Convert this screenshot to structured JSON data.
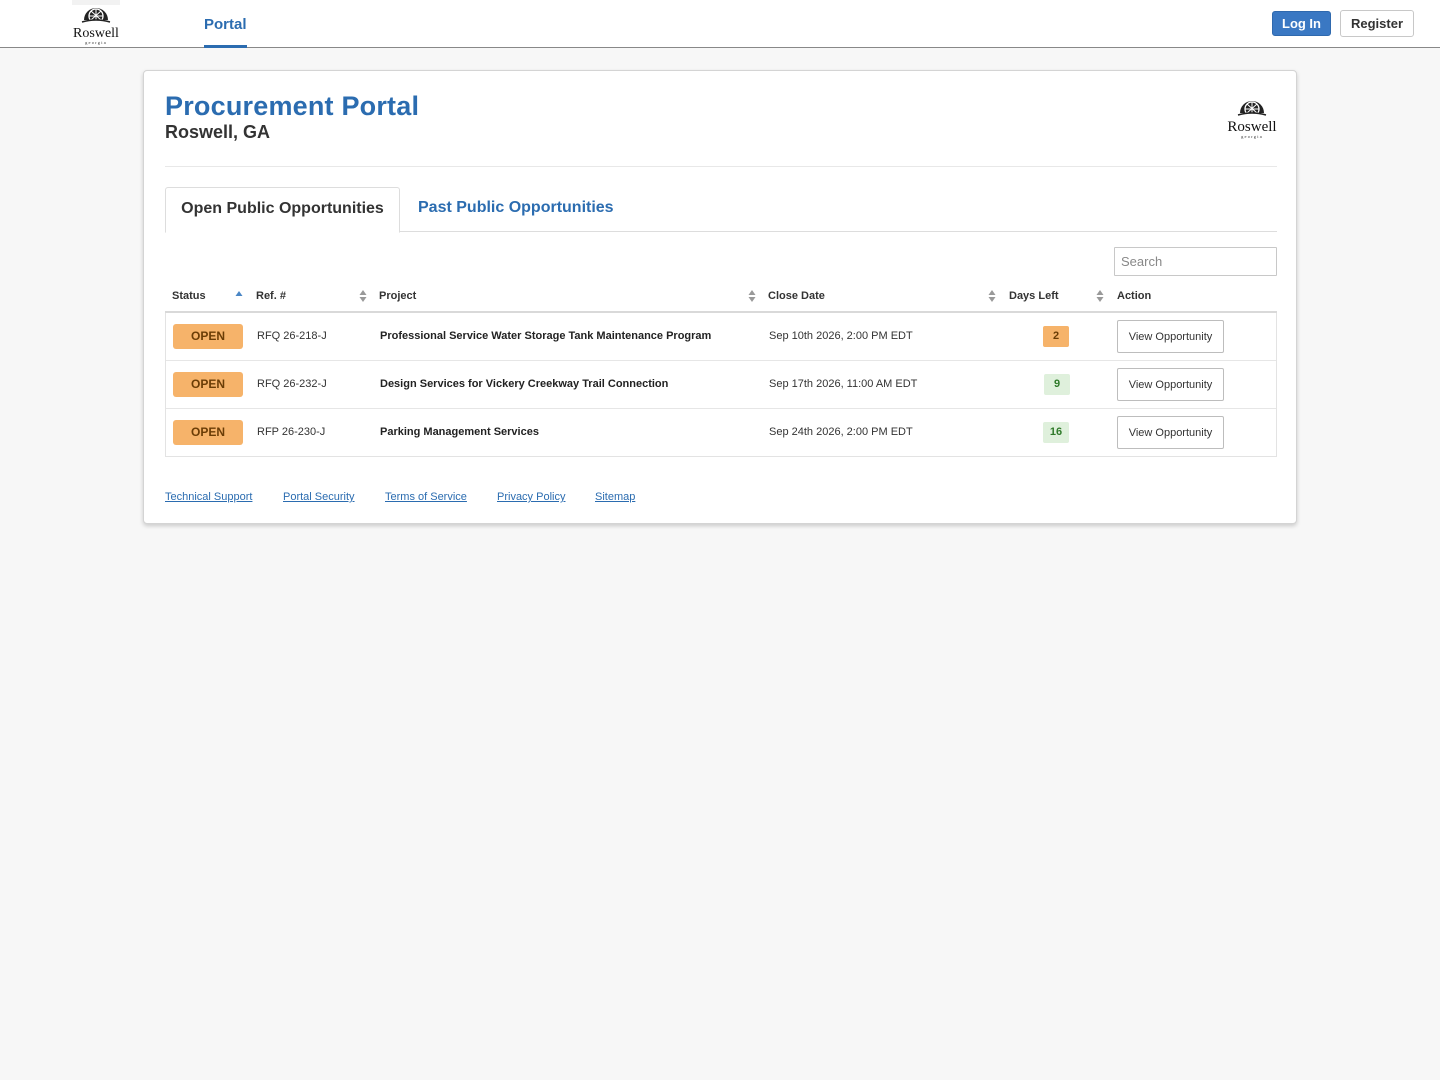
{
  "nav": {
    "logo_text": "Roswell",
    "logo_subtext": "georgia",
    "tab_label": "Portal",
    "login_label": "Log In",
    "register_label": "Register"
  },
  "header": {
    "title": "Procurement Portal",
    "subtitle": "Roswell, GA",
    "logo_text": "Roswell",
    "logo_subtext": "georgia"
  },
  "tabs": [
    {
      "label": "Open Public Opportunities",
      "active": true
    },
    {
      "label": "Past Public Opportunities",
      "active": false
    }
  ],
  "search": {
    "placeholder": "Search",
    "value": ""
  },
  "table": {
    "columns": [
      "Status",
      "Ref. #",
      "Project",
      "Close Date",
      "Days Left",
      "Action"
    ],
    "sorted_column": "Status",
    "sort_direction": "ascending",
    "rows": [
      {
        "status": "OPEN",
        "ref": "RFQ 26-218-J",
        "project": "Professional Service Water Storage Tank Maintenance Program",
        "close_date": "Sep 10th 2026, 2:00 PM EDT",
        "days_left": "2",
        "days_color": "orange",
        "action": "View Opportunity"
      },
      {
        "status": "OPEN",
        "ref": "RFQ 26-232-J",
        "project": "Design Services for Vickery Creekway Trail Connection",
        "close_date": "Sep 17th 2026, 11:00 AM EDT",
        "days_left": "9",
        "days_color": "green",
        "action": "View Opportunity"
      },
      {
        "status": "OPEN",
        "ref": "RFP 26-230-J",
        "project": "Parking Management Services",
        "close_date": "Sep 24th 2026, 2:00 PM EDT",
        "days_left": "16",
        "days_color": "green",
        "action": "View Opportunity"
      }
    ]
  },
  "footer": {
    "links": [
      "Technical Support",
      "Portal Security",
      "Terms of Service",
      "Privacy Policy",
      "Sitemap"
    ]
  },
  "colors": {
    "brand_blue": "#2b6cb0",
    "login_button": "#3a78c3",
    "status_orange": "#f6b36a",
    "days_green_bg": "#dff0dc",
    "page_background": "#f7f7f7"
  }
}
